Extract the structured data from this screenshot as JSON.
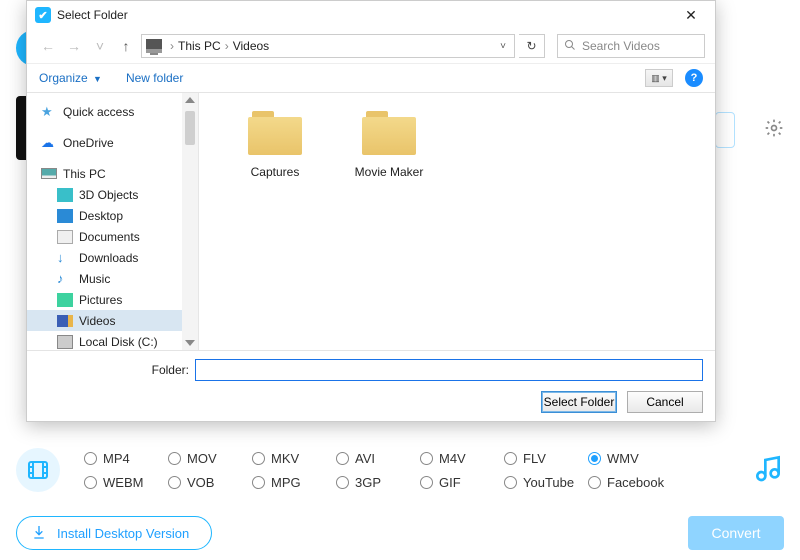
{
  "bg": {
    "gear_icon": "gear"
  },
  "dialog": {
    "title": "Select Folder",
    "close": "✕",
    "nav": {
      "back": "←",
      "forward": "→",
      "dropdown": "˅",
      "up": "↑",
      "crumbs": [
        "This PC",
        "Videos"
      ],
      "refresh": "↻",
      "search_placeholder": "Search Videos"
    },
    "toolbar": {
      "organize": "Organize",
      "newfolder": "New folder",
      "view": "▥ ▾",
      "help": "?"
    },
    "sidebar": {
      "items": [
        {
          "label": "Quick access",
          "icon_name": "star-icon",
          "cls": "ic-star",
          "glyph": "★",
          "indent": false
        },
        {
          "label": "OneDrive",
          "icon_name": "cloud-icon",
          "cls": "ic-cloud",
          "glyph": "☁",
          "indent": false
        },
        {
          "label": "This PC",
          "icon_name": "pc-icon",
          "cls": "ic-pc",
          "glyph": "",
          "indent": false
        },
        {
          "label": "3D Objects",
          "icon_name": "cube-icon",
          "cls": "ic-3d",
          "glyph": "",
          "indent": true
        },
        {
          "label": "Desktop",
          "icon_name": "desktop-icon",
          "cls": "ic-desk",
          "glyph": "",
          "indent": true
        },
        {
          "label": "Documents",
          "icon_name": "document-icon",
          "cls": "ic-doc",
          "glyph": "",
          "indent": true
        },
        {
          "label": "Downloads",
          "icon_name": "download-icon",
          "cls": "ic-dl",
          "glyph": "↓",
          "indent": true
        },
        {
          "label": "Music",
          "icon_name": "music-icon",
          "cls": "ic-music",
          "glyph": "♪",
          "indent": true
        },
        {
          "label": "Pictures",
          "icon_name": "pictures-icon",
          "cls": "ic-pic",
          "glyph": "",
          "indent": true
        },
        {
          "label": "Videos",
          "icon_name": "videos-icon",
          "cls": "ic-vid",
          "glyph": "",
          "indent": true,
          "selected": true
        },
        {
          "label": "Local Disk (C:)",
          "icon_name": "disk-icon",
          "cls": "ic-disk",
          "glyph": "",
          "indent": true
        }
      ]
    },
    "content": {
      "folders": [
        {
          "name": "Captures"
        },
        {
          "name": "Movie Maker"
        }
      ]
    },
    "footer": {
      "folder_label": "Folder:",
      "folder_value": "",
      "select_btn": "Select Folder",
      "cancel_btn": "Cancel"
    }
  },
  "formats": {
    "row1": [
      "MP4",
      "MOV",
      "MKV",
      "AVI",
      "M4V",
      "FLV",
      "WMV"
    ],
    "row2": [
      "WEBM",
      "VOB",
      "MPG",
      "3GP",
      "GIF",
      "YouTube",
      "Facebook"
    ],
    "selected": "WMV"
  },
  "bottom": {
    "install": "Install Desktop Version",
    "convert": "Convert"
  }
}
